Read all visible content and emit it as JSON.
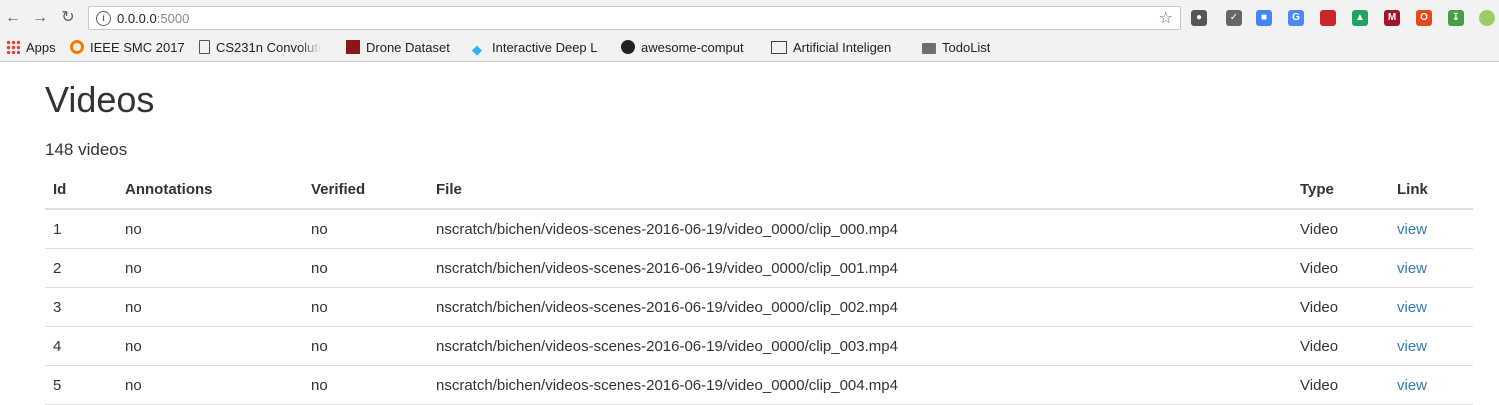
{
  "browser": {
    "url_host": "0.0.0.0",
    "url_port": ":5000",
    "bookmarks": [
      {
        "label": "Apps",
        "icon": "apps-grid-icon"
      },
      {
        "label": "IEEE SMC 2017",
        "icon": "ieee-logo-icon"
      },
      {
        "label": "CS231n Convoluti",
        "icon": "page-icon"
      },
      {
        "label": "Drone Dataset",
        "icon": "stanford-logo-icon"
      },
      {
        "label": "Interactive Deep L",
        "icon": "diamond-icon"
      },
      {
        "label": "awesome-comput",
        "icon": "github-icon"
      },
      {
        "label": "Artificial Inteligen",
        "icon": "book-icon"
      },
      {
        "label": "TodoList",
        "icon": "folder-icon"
      }
    ]
  },
  "page": {
    "title": "Videos",
    "count_text": "148 videos"
  },
  "table": {
    "headers": [
      "Id",
      "Annotations",
      "Verified",
      "File",
      "Type",
      "Link"
    ],
    "rows": [
      {
        "id": "1",
        "annotations": "no",
        "verified": "no",
        "file": "nscratch/bichen/videos-scenes-2016-06-19/video_0000/clip_000.mp4",
        "type": "Video",
        "link": "view"
      },
      {
        "id": "2",
        "annotations": "no",
        "verified": "no",
        "file": "nscratch/bichen/videos-scenes-2016-06-19/video_0000/clip_001.mp4",
        "type": "Video",
        "link": "view"
      },
      {
        "id": "3",
        "annotations": "no",
        "verified": "no",
        "file": "nscratch/bichen/videos-scenes-2016-06-19/video_0000/clip_002.mp4",
        "type": "Video",
        "link": "view"
      },
      {
        "id": "4",
        "annotations": "no",
        "verified": "no",
        "file": "nscratch/bichen/videos-scenes-2016-06-19/video_0000/clip_003.mp4",
        "type": "Video",
        "link": "view"
      },
      {
        "id": "5",
        "annotations": "no",
        "verified": "no",
        "file": "nscratch/bichen/videos-scenes-2016-06-19/video_0000/clip_004.mp4",
        "type": "Video",
        "link": "view"
      }
    ]
  },
  "colors": {
    "link": "#337ab7",
    "text": "#333333",
    "border": "#dddddd"
  }
}
